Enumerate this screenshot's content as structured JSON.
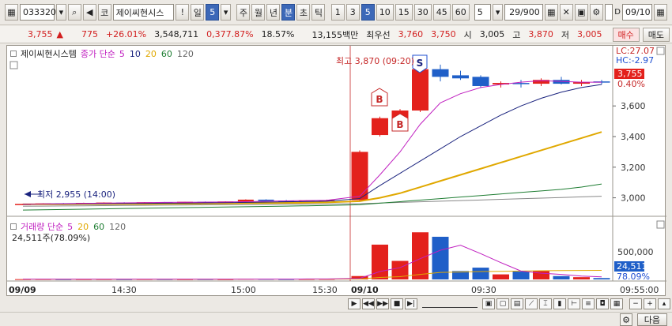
{
  "toolbar": {
    "code": "033320",
    "market_label": "코",
    "stock_name": "제이씨현시스",
    "period_day": "일",
    "period_day_num": "5",
    "period_week": "주",
    "period_month": "월",
    "period_year": "년",
    "period_min": "분",
    "period_sec": "초",
    "period_tick": "틱",
    "interval_buttons": [
      "1",
      "3",
      "5",
      "10",
      "15",
      "30",
      "45",
      "60"
    ],
    "interval_selected": "5",
    "interval_value": "5",
    "page_count": "29/900",
    "date_value": "09/10"
  },
  "quote": {
    "price": "3,755",
    "change": "775",
    "change_pct": "+26.01%",
    "volume": "3,548,711",
    "volume_ratio": "0,377.87%",
    "turnover": "18.57%",
    "amount": "13,155백만",
    "hoga_label": "최우선",
    "ask": "3,760",
    "bid": "3,750",
    "open_label": "시",
    "open": "3,005",
    "high_label": "고",
    "high": "3,870",
    "low_label": "저",
    "low": "3,005",
    "buy_label": "매수",
    "sell_label": "매도"
  },
  "price_panel": {
    "stock_label": "제이씨현시스템",
    "ma_label": "종가 단순",
    "ma_periods": [
      "5",
      "10",
      "20",
      "60",
      "120"
    ],
    "ma_colors": [
      "#c020c0",
      "#1a237e",
      "#e0a800",
      "#1e7d32",
      "#666666"
    ],
    "high_annotation": "최고 3,870 (09:20)",
    "low_annotation": "최저 2,955 (14:00)",
    "lc_label": "LC:27.07",
    "hc_label": "HC:-2.97",
    "current_price_tag": "3,755",
    "current_pct_tag": "0.40%",
    "y_ticks": [
      "3,600",
      "3,400",
      "3,200",
      "3,000"
    ]
  },
  "volume_panel": {
    "label": "거래량 단순",
    "ma_periods": [
      "5",
      "20",
      "60",
      "120"
    ],
    "volume_text": "24,511주(78.09%)",
    "y_tick": "500,000",
    "current_volume_tag": "24,511",
    "current_vol_pct_tag": "78.09%"
  },
  "time_axis": {
    "date_start": "09/09",
    "ticks": [
      "14:30",
      "15:00",
      "15:30"
    ],
    "date_break": "09/10",
    "tick_after": "09:30",
    "end_time": "09:55:00"
  },
  "footer": {
    "next_label": "다음"
  },
  "markers": {
    "buy_letter": "B",
    "sell_letter": "S"
  },
  "colors": {
    "up": "#e3211c",
    "down": "#1f5fc8",
    "accent": "#3c68b8"
  },
  "chart_data": {
    "type": "candlestick",
    "title": "",
    "y_range": [
      2900,
      3900
    ],
    "candles": [
      {
        "o": 2958,
        "h": 2962,
        "l": 2955,
        "c": 2960
      },
      {
        "o": 2960,
        "h": 2965,
        "l": 2958,
        "c": 2964
      },
      {
        "o": 2964,
        "h": 2966,
        "l": 2962,
        "c": 2963
      },
      {
        "o": 2963,
        "h": 2968,
        "l": 2962,
        "c": 2967
      },
      {
        "o": 2967,
        "h": 2970,
        "l": 2965,
        "c": 2969
      },
      {
        "o": 2969,
        "h": 2971,
        "l": 2966,
        "c": 2968
      },
      {
        "o": 2968,
        "h": 2972,
        "l": 2967,
        "c": 2971
      },
      {
        "o": 2971,
        "h": 2973,
        "l": 2969,
        "c": 2970
      },
      {
        "o": 2970,
        "h": 2975,
        "l": 2969,
        "c": 2974
      },
      {
        "o": 2974,
        "h": 2976,
        "l": 2972,
        "c": 2973
      },
      {
        "o": 2973,
        "h": 2977,
        "l": 2972,
        "c": 2976
      },
      {
        "o": 2976,
        "h": 2990,
        "l": 2975,
        "c": 2988
      },
      {
        "o": 2988,
        "h": 2990,
        "l": 2980,
        "c": 2982
      },
      {
        "o": 2982,
        "h": 2986,
        "l": 2978,
        "c": 2980
      },
      {
        "o": 2980,
        "h": 2984,
        "l": 2978,
        "c": 2983
      },
      {
        "o": 2983,
        "h": 2988,
        "l": 2980,
        "c": 2985
      },
      {
        "o": 2985,
        "h": 3310,
        "l": 2980,
        "c": 3300
      },
      {
        "o": 3410,
        "h": 3530,
        "l": 3400,
        "c": 3520
      },
      {
        "o": 3520,
        "h": 3580,
        "l": 3480,
        "c": 3570
      },
      {
        "o": 3570,
        "h": 3870,
        "l": 3560,
        "c": 3840
      },
      {
        "o": 3840,
        "h": 3870,
        "l": 3760,
        "c": 3790
      },
      {
        "o": 3800,
        "h": 3830,
        "l": 3770,
        "c": 3780
      },
      {
        "o": 3790,
        "h": 3800,
        "l": 3720,
        "c": 3730
      },
      {
        "o": 3740,
        "h": 3760,
        "l": 3720,
        "c": 3750
      },
      {
        "o": 3750,
        "h": 3770,
        "l": 3720,
        "c": 3745
      },
      {
        "o": 3745,
        "h": 3780,
        "l": 3730,
        "c": 3770
      },
      {
        "o": 3770,
        "h": 3790,
        "l": 3740,
        "c": 3745
      },
      {
        "o": 3745,
        "h": 3770,
        "l": 3730,
        "c": 3755
      },
      {
        "o": 3760,
        "h": 3770,
        "l": 3740,
        "c": 3755
      }
    ],
    "ma5": [
      2958,
      2960,
      2962,
      2964,
      2965,
      2967,
      2968,
      2970,
      2971,
      2972,
      2973,
      2975,
      2978,
      2980,
      2982,
      2984,
      3010,
      3150,
      3300,
      3480,
      3620,
      3680,
      3720,
      3740,
      3755,
      3765,
      3760,
      3755,
      3755
    ],
    "ma10": [
      2958,
      2959,
      2960,
      2961,
      2962,
      2963,
      2964,
      2965,
      2966,
      2967,
      2968,
      2970,
      2972,
      2974,
      2976,
      2978,
      2995,
      3080,
      3160,
      3240,
      3320,
      3400,
      3470,
      3540,
      3600,
      3650,
      3690,
      3720,
      3740
    ],
    "ma20": [
      2958,
      2958,
      2958,
      2959,
      2959,
      2960,
      2960,
      2961,
      2962,
      2963,
      2964,
      2965,
      2966,
      2967,
      2968,
      2970,
      2978,
      3000,
      3030,
      3070,
      3110,
      3150,
      3190,
      3230,
      3270,
      3310,
      3350,
      3390,
      3430
    ],
    "ma60": [
      2920,
      2922,
      2924,
      2926,
      2928,
      2930,
      2932,
      2934,
      2936,
      2938,
      2940,
      2942,
      2944,
      2946,
      2948,
      2950,
      2955,
      2965,
      2975,
      2985,
      2995,
      3005,
      3015,
      3025,
      3035,
      3045,
      3055,
      3070,
      3090
    ],
    "ma120": [
      2945,
      2946,
      2947,
      2948,
      2949,
      2950,
      2951,
      2952,
      2953,
      2954,
      2955,
      2956,
      2957,
      2958,
      2959,
      2960,
      2962,
      2966,
      2970,
      2974,
      2978,
      2982,
      2986,
      2990,
      2994,
      2998,
      3002,
      3006,
      3010
    ],
    "volume": [
      5000,
      6000,
      4000,
      5000,
      5500,
      4000,
      6000,
      5000,
      4500,
      5000,
      4000,
      12000,
      9000,
      6000,
      7000,
      8000,
      60000,
      620000,
      330000,
      840000,
      760000,
      150000,
      210000,
      90000,
      140000,
      150000,
      60000,
      40000,
      24511
    ],
    "volume_ma5": [
      5000,
      5000,
      5000,
      5000,
      5000,
      5000,
      5000,
      5000,
      5000,
      5000,
      5000,
      6000,
      7000,
      7000,
      8000,
      8000,
      20000,
      140000,
      210000,
      370000,
      520000,
      610000,
      460000,
      300000,
      150000,
      110000,
      90000,
      60000,
      45000
    ],
    "volume_ma20": [
      4000,
      4000,
      4000,
      4000,
      4000,
      4000,
      4000,
      4000,
      4000,
      4000,
      4000,
      4500,
      5000,
      5000,
      5500,
      5500,
      8000,
      35000,
      50000,
      90000,
      125000,
      132000,
      140000,
      144000,
      150000,
      155000,
      158000,
      160000,
      161000
    ],
    "volume_ylim": [
      0,
      900000
    ]
  }
}
